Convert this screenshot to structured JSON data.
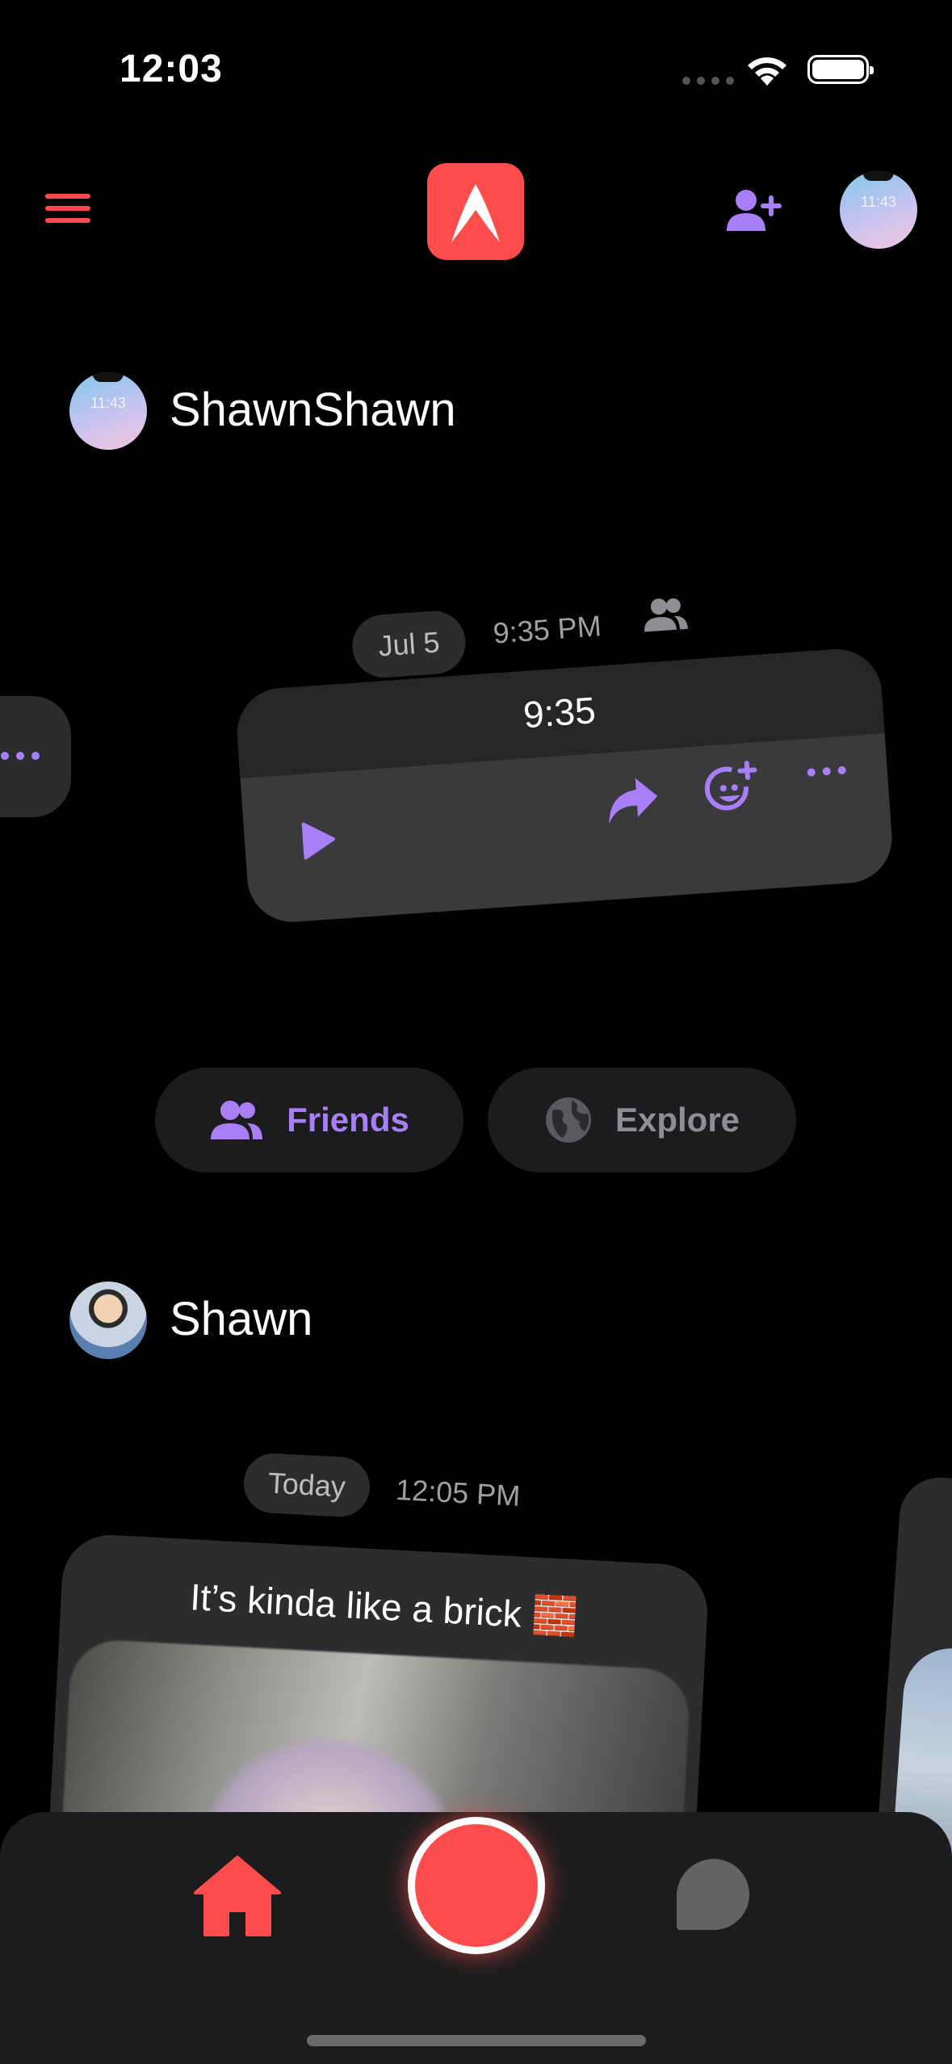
{
  "status_bar": {
    "time": "12:03"
  },
  "header": {
    "menu_icon": "hamburger-icon",
    "logo_icon": "app-logo-icon",
    "add_friend_icon": "add-friend-icon"
  },
  "feed": [
    {
      "username": "ShawnShawn",
      "date_pill": "Jul 5",
      "time": "9:35 PM",
      "message_text": "9:35",
      "controls": [
        "play-icon",
        "share-icon",
        "add-reaction-icon",
        "more-icon"
      ]
    },
    {
      "username": "Shawn",
      "date_pill": "Today",
      "time": "12:05 PM",
      "caption": "It’s kinda like a brick 🧱"
    }
  ],
  "tabs": [
    {
      "label": "Friends",
      "icon": "friends-icon",
      "active": true
    },
    {
      "label": "Explore",
      "icon": "globe-icon",
      "active": false
    }
  ],
  "bottom_nav": [
    "home-icon",
    "record-button",
    "chat-icon"
  ],
  "colors": {
    "accent": "#ff4d4d",
    "purple": "#a87ff7",
    "card": "#2c2c2e"
  }
}
